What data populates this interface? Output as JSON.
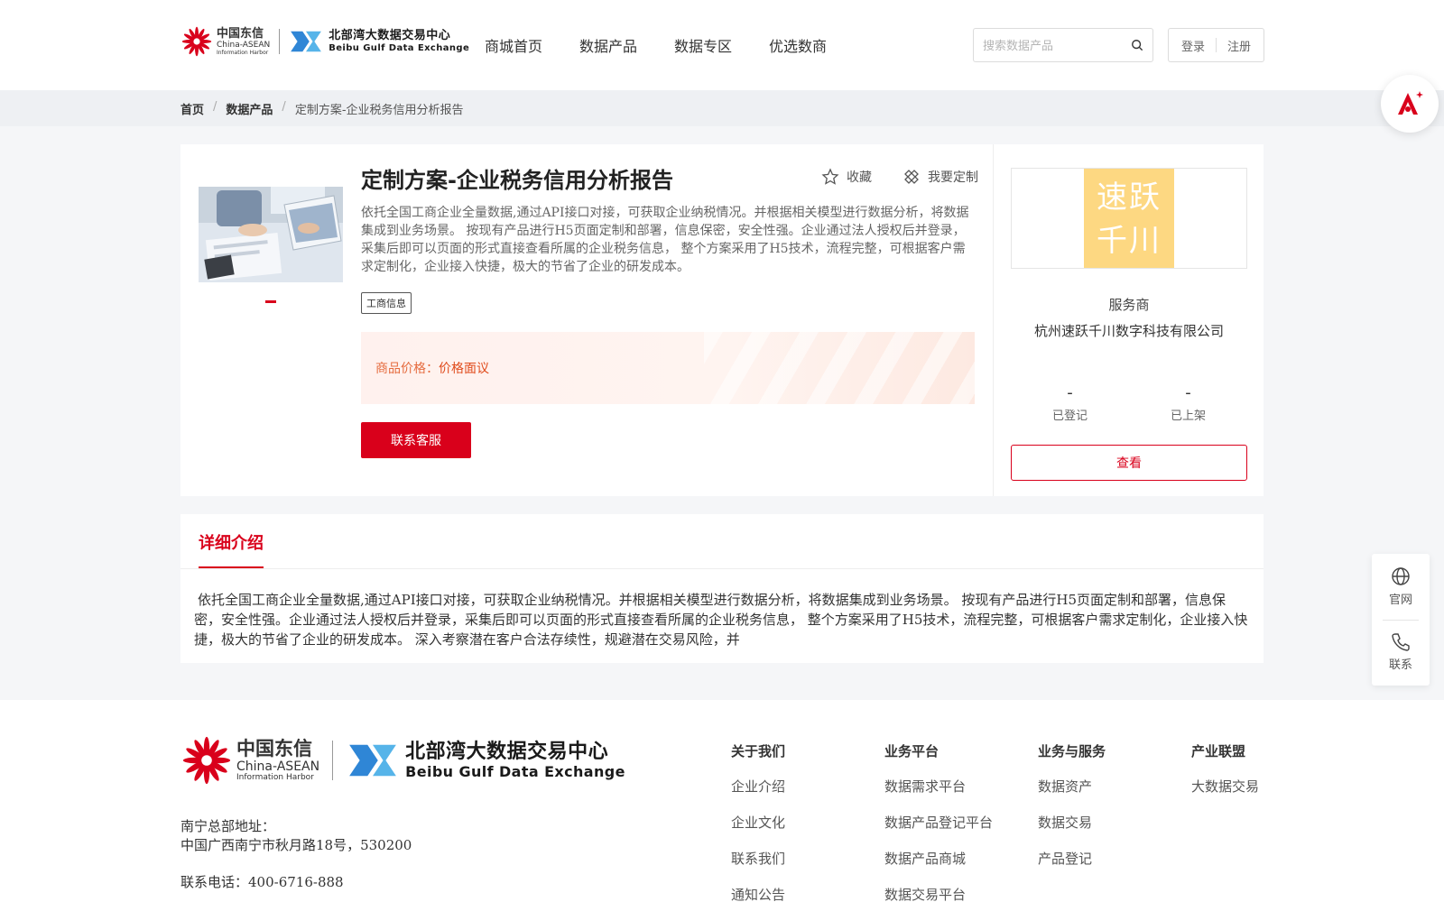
{
  "header": {
    "logo_cn": {
      "line1": "中国东信",
      "line2": "China-ASEAN",
      "line3": "Information Harbor"
    },
    "logo_bx": {
      "line1": "北部湾大数据交易中心",
      "line2": "Beibu Gulf Data Exchange"
    },
    "nav": [
      "商城首页",
      "数据产品",
      "数据专区",
      "优选数商"
    ],
    "search_placeholder": "搜索数据产品",
    "login": "登录",
    "register": "注册"
  },
  "breadcrumb": {
    "home": "首页",
    "section": "数据产品",
    "current": "定制方案-企业税务信用分析报告"
  },
  "product": {
    "title": "定制方案-企业税务信用分析报告",
    "favorite": "收藏",
    "customize": "我要定制",
    "description": "依托全国工商企业全量数据,通过API接口对接，可获取企业纳税情况。并根据相关模型进行数据分析，将数据集成到业务场景。 按现有产品进行H5页面定制和部署，信息保密，安全性强。企业通过法人授权后并登录，采集后即可以页面的形式直接查看所属的企业税务信息， 整个方案采用了H5技术，流程完整，可根据客户需求定制化，企业接入快捷，极大的节省了企业的研发成本。",
    "tag": "工商信息",
    "price_label": "商品价格：",
    "price_value": "价格面议",
    "contact_button": "联系客服"
  },
  "seller": {
    "logo_line1": "速跃",
    "logo_line2": "千川",
    "role": "服务商",
    "name": "杭州速跃千川数字科技有限公司",
    "stats": [
      {
        "value": "-",
        "label": "已登记"
      },
      {
        "value": "-",
        "label": "已上架"
      }
    ],
    "view_button": "查看"
  },
  "detail": {
    "tab": "详细介绍",
    "text": "依托全国工商企业全量数据,通过API接口对接，可获取企业纳税情况。并根据相关模型进行数据分析，将数据集成到业务场景。 按现有产品进行H5页面定制和部署，信息保密，安全性强。企业通过法人授权后并登录，采集后即可以页面的形式直接查看所属的企业税务信息， 整个方案采用了H5技术，流程完整，可根据客户需求定制化，企业接入快捷，极大的节省了企业的研发成本。 深入考察潜在客户合法存续性，规避潜在交易风险，并"
  },
  "sidefloat": {
    "site": "官网",
    "contact": "联系"
  },
  "footer": {
    "address_label": "南宁总部地址：",
    "address": "中国广西南宁市秋月路18号，530200",
    "phone": "联系电话：400-6716-888",
    "columns": [
      {
        "title": "关于我们",
        "items": [
          "企业介绍",
          "企业文化",
          "联系我们",
          "通知公告"
        ]
      },
      {
        "title": "业务平台",
        "items": [
          "数据需求平台",
          "数据产品登记平台",
          "数据产品商城",
          "数据交易平台"
        ]
      },
      {
        "title": "业务与服务",
        "items": [
          "数据资产",
          "数据交易",
          "产品登记"
        ]
      },
      {
        "title": "产业联盟",
        "items": [
          "大数据交易"
        ]
      }
    ]
  },
  "colors": {
    "brand_red": "#d9001b",
    "price_orange": "#e56b3e",
    "seller_logo_bg": "#fdd882",
    "bx_blue": "#2f86d6"
  }
}
